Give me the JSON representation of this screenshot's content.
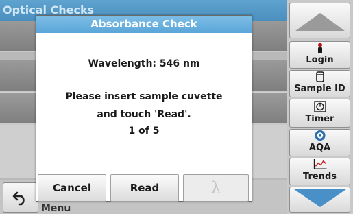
{
  "screen": {
    "title": "Optical Checks",
    "menu_label": "Menu"
  },
  "dialog": {
    "title": "Absorbance Check",
    "wavelength_line": "Wavelength: 546 nm",
    "instruction_line1": "Please insert sample cuvette",
    "instruction_line2": "and touch 'Read'.",
    "progress": "1 of 5",
    "buttons": {
      "cancel": "Cancel",
      "read": "Read",
      "lambda": "λ"
    }
  },
  "sidebar": {
    "items": [
      {
        "label": "Login",
        "icon": "person-icon"
      },
      {
        "label": "Sample ID",
        "icon": "sample-vial-icon"
      },
      {
        "label": "Timer",
        "icon": "timer-icon"
      },
      {
        "label": "AQA",
        "icon": "aqa-icon"
      },
      {
        "label": "Trends",
        "icon": "trends-chart-icon"
      }
    ]
  },
  "colors": {
    "accent": "#5aa6d8",
    "scroll_down": "#4a90c8",
    "scroll_up_disabled": "#9a9a9a"
  }
}
